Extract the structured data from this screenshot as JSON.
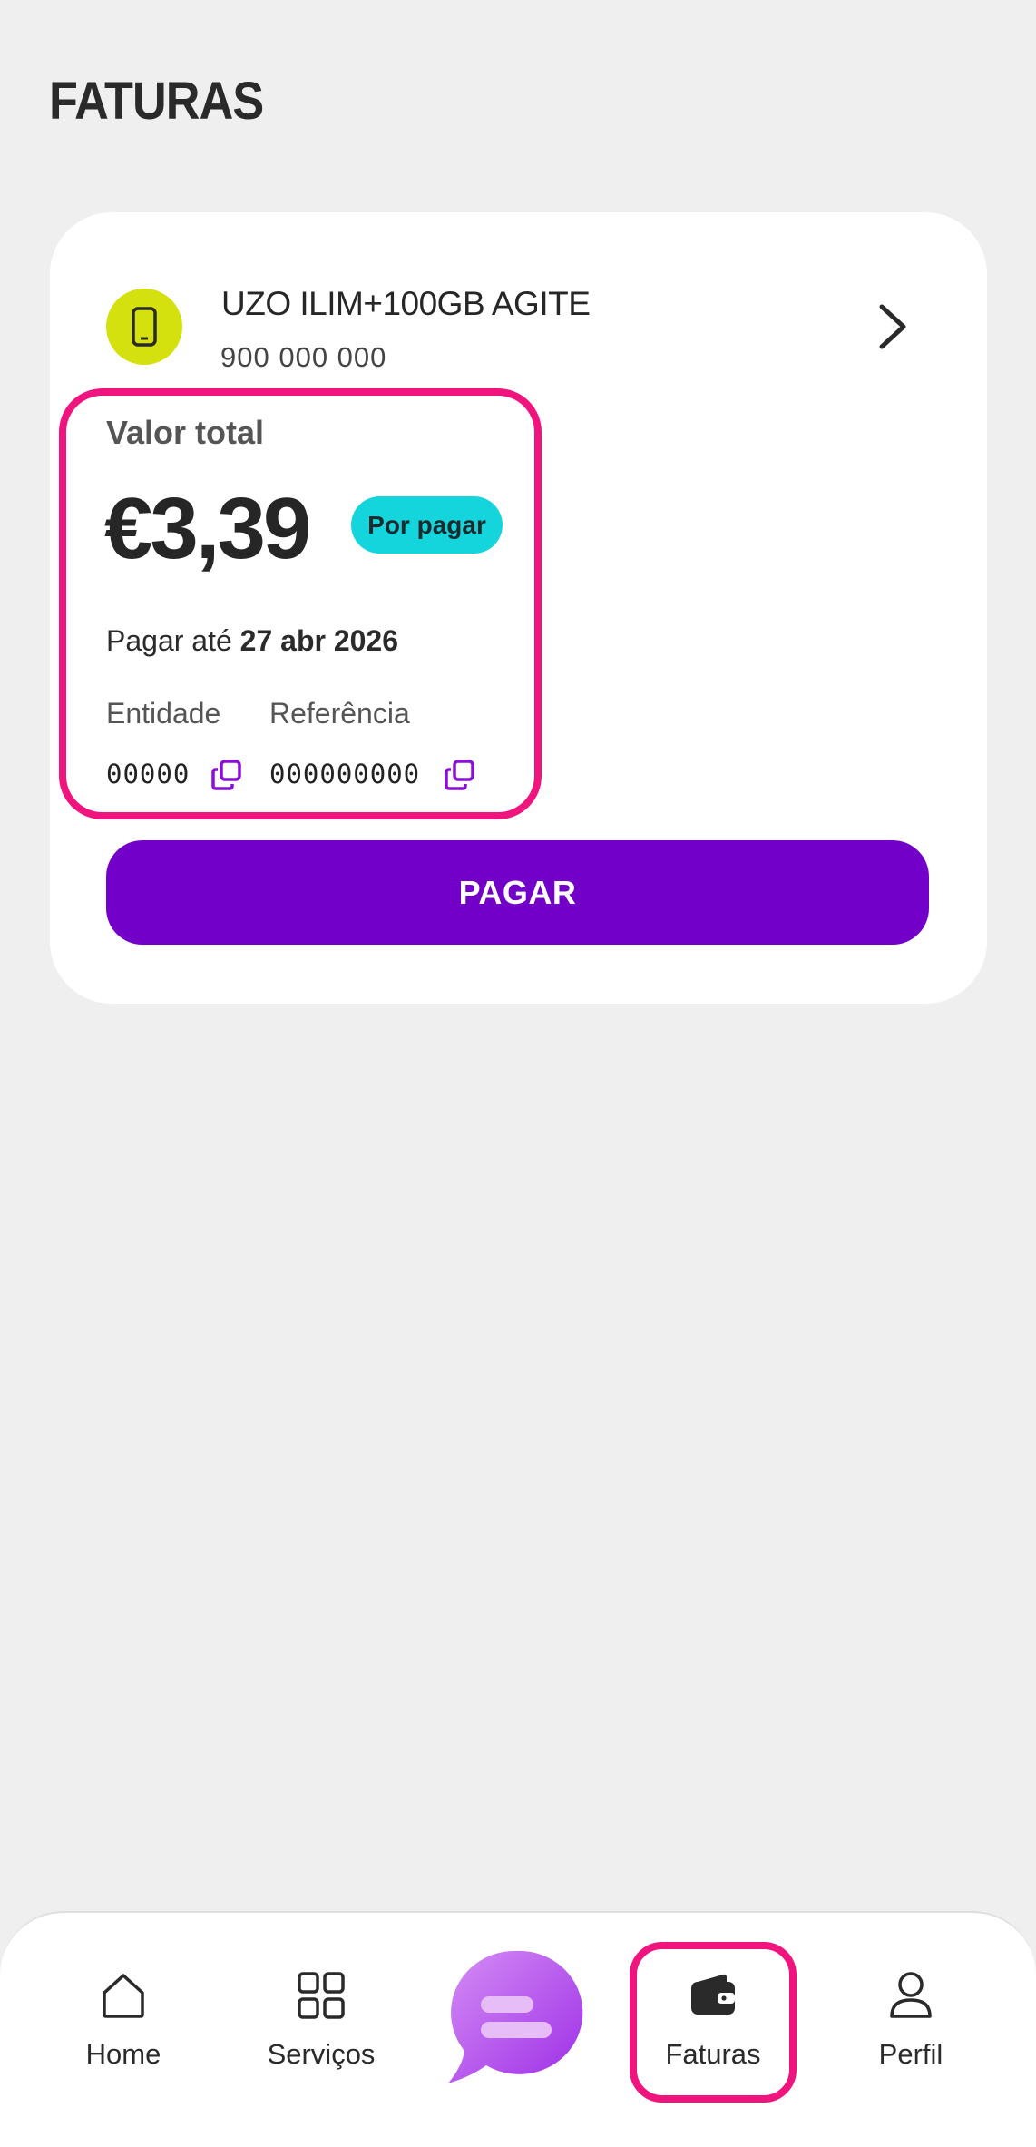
{
  "page": {
    "title": "FATURAS"
  },
  "invoice": {
    "plan_name": "UZO ILIM+100GB AGITE",
    "phone_number": "900 000 000",
    "total_label": "Valor total",
    "amount": "€3,39",
    "status": "Por pagar",
    "due_prefix": "Pagar até",
    "due_date": "27 abr 2026",
    "entity_label": "Entidade",
    "entity_value": "00000",
    "reference_label": "Referência",
    "reference_value": "000000000",
    "pay_button": "PAGAR"
  },
  "nav": {
    "items": [
      {
        "label": "Home",
        "icon": "home-icon"
      },
      {
        "label": "Serviços",
        "icon": "grid-icon"
      },
      {
        "label": "Faturas",
        "icon": "wallet-icon",
        "active": true
      },
      {
        "label": "Perfil",
        "icon": "user-icon"
      }
    ],
    "center": {
      "icon": "chat-bubble-icon"
    }
  },
  "colors": {
    "accent_purple": "#7200c8",
    "highlight_pink": "#f0147e",
    "status_cyan": "#14d4dc",
    "icon_lime": "#d4e10f",
    "background": "#efefef"
  }
}
